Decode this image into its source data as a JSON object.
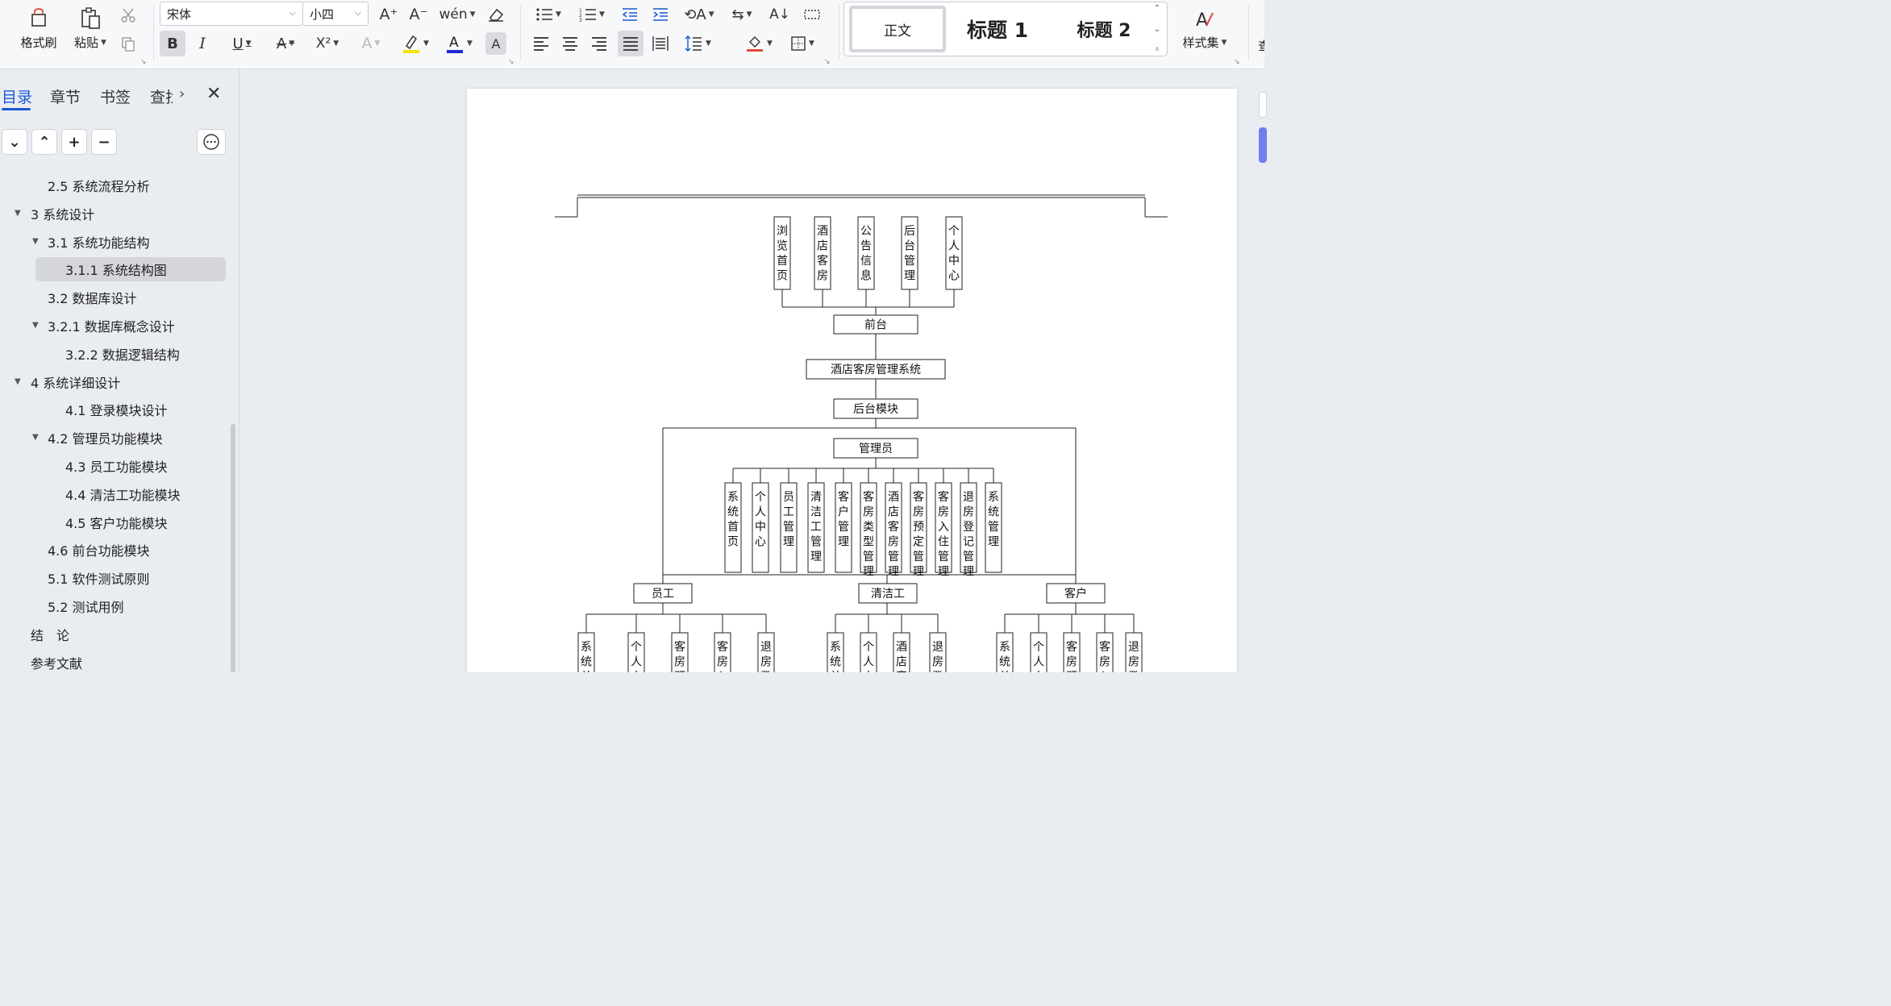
{
  "ribbon": {
    "format_painter": "格式刷",
    "paste": "粘贴",
    "font_name": "宋体",
    "font_size": "小四",
    "bold": "B",
    "italic": "I",
    "underline": "U",
    "superscript": "X²",
    "styles": {
      "normal": "正文",
      "heading1": "标题 1",
      "heading2": "标题 2"
    },
    "style_set": "样式集",
    "far_right": "查",
    "highlight_color": "#f5e400",
    "font_color": "#1f2ad6"
  },
  "sidebar": {
    "tabs": [
      "目录",
      "章节",
      "书签",
      "查找"
    ],
    "toc": [
      {
        "label": "2.5 系统流程分析",
        "level": 2,
        "toggle": ""
      },
      {
        "label": "3 系统设计",
        "level": 1,
        "toggle": "▼"
      },
      {
        "label": "3.1 系统功能结构",
        "level": 2,
        "toggle": "▼"
      },
      {
        "label": "3.1.1 系统结构图",
        "level": 3,
        "toggle": ""
      },
      {
        "label": "3.2 数据库设计",
        "level": 2,
        "toggle": ""
      },
      {
        "label": "3.2.1  数据库概念设计",
        "level": 2,
        "toggle": "▼"
      },
      {
        "label": "3.2.2 数据逻辑结构",
        "level": 3,
        "toggle": ""
      },
      {
        "label": "4 系统详细设计",
        "level": 1,
        "toggle": "▼"
      },
      {
        "label": "4.1 登录模块设计",
        "level": 3,
        "toggle": ""
      },
      {
        "label": "4.2 管理员功能模块",
        "level": 2,
        "toggle": "▼"
      },
      {
        "label": "4.3  员工功能模块",
        "level": 3,
        "toggle": ""
      },
      {
        "label": "4.4  清洁工功能模块",
        "level": 3,
        "toggle": ""
      },
      {
        "label": "4.5  客户功能模块",
        "level": 3,
        "toggle": ""
      },
      {
        "label": "4.6  前台功能模块",
        "level": 2,
        "toggle": ""
      },
      {
        "label": "5.1 软件测试原则",
        "level": 2,
        "toggle": ""
      },
      {
        "label": "5.2 测试用例",
        "level": 2,
        "toggle": ""
      },
      {
        "label": "结　论",
        "level": 1,
        "toggle": ""
      },
      {
        "label": "参考文献",
        "level": 1,
        "toggle": ""
      }
    ]
  },
  "diagram": {
    "frontend_modules": [
      "浏览首页",
      "酒店客房",
      "公告信息",
      "后台管理",
      "个人中心"
    ],
    "frontend": "前台",
    "system": "酒店客房管理系统",
    "backend": "后台模块",
    "admin": "管理员",
    "admin_modules": [
      "系统首页",
      "个人中心",
      "员工管理",
      "清洁工管理",
      "客户管理",
      "客房类型管理",
      "酒店客房管理",
      "客房预定管理",
      "客房入住管理",
      "退房登记管理",
      "系统管理"
    ],
    "employee": "员工",
    "employee_modules": [
      "系统首页",
      "个人中心",
      "客房预定管理",
      "客房入住管理",
      "退房登记管理"
    ],
    "cleaner": "清洁工",
    "cleaner_modules": [
      "系统首页",
      "个人中心",
      "酒店客房管理",
      "退房登记管理"
    ],
    "customer": "客户",
    "customer_modules": [
      "系统首页",
      "个人中心",
      "客房预定管理",
      "客房入住管理",
      "退房登记管理"
    ]
  }
}
